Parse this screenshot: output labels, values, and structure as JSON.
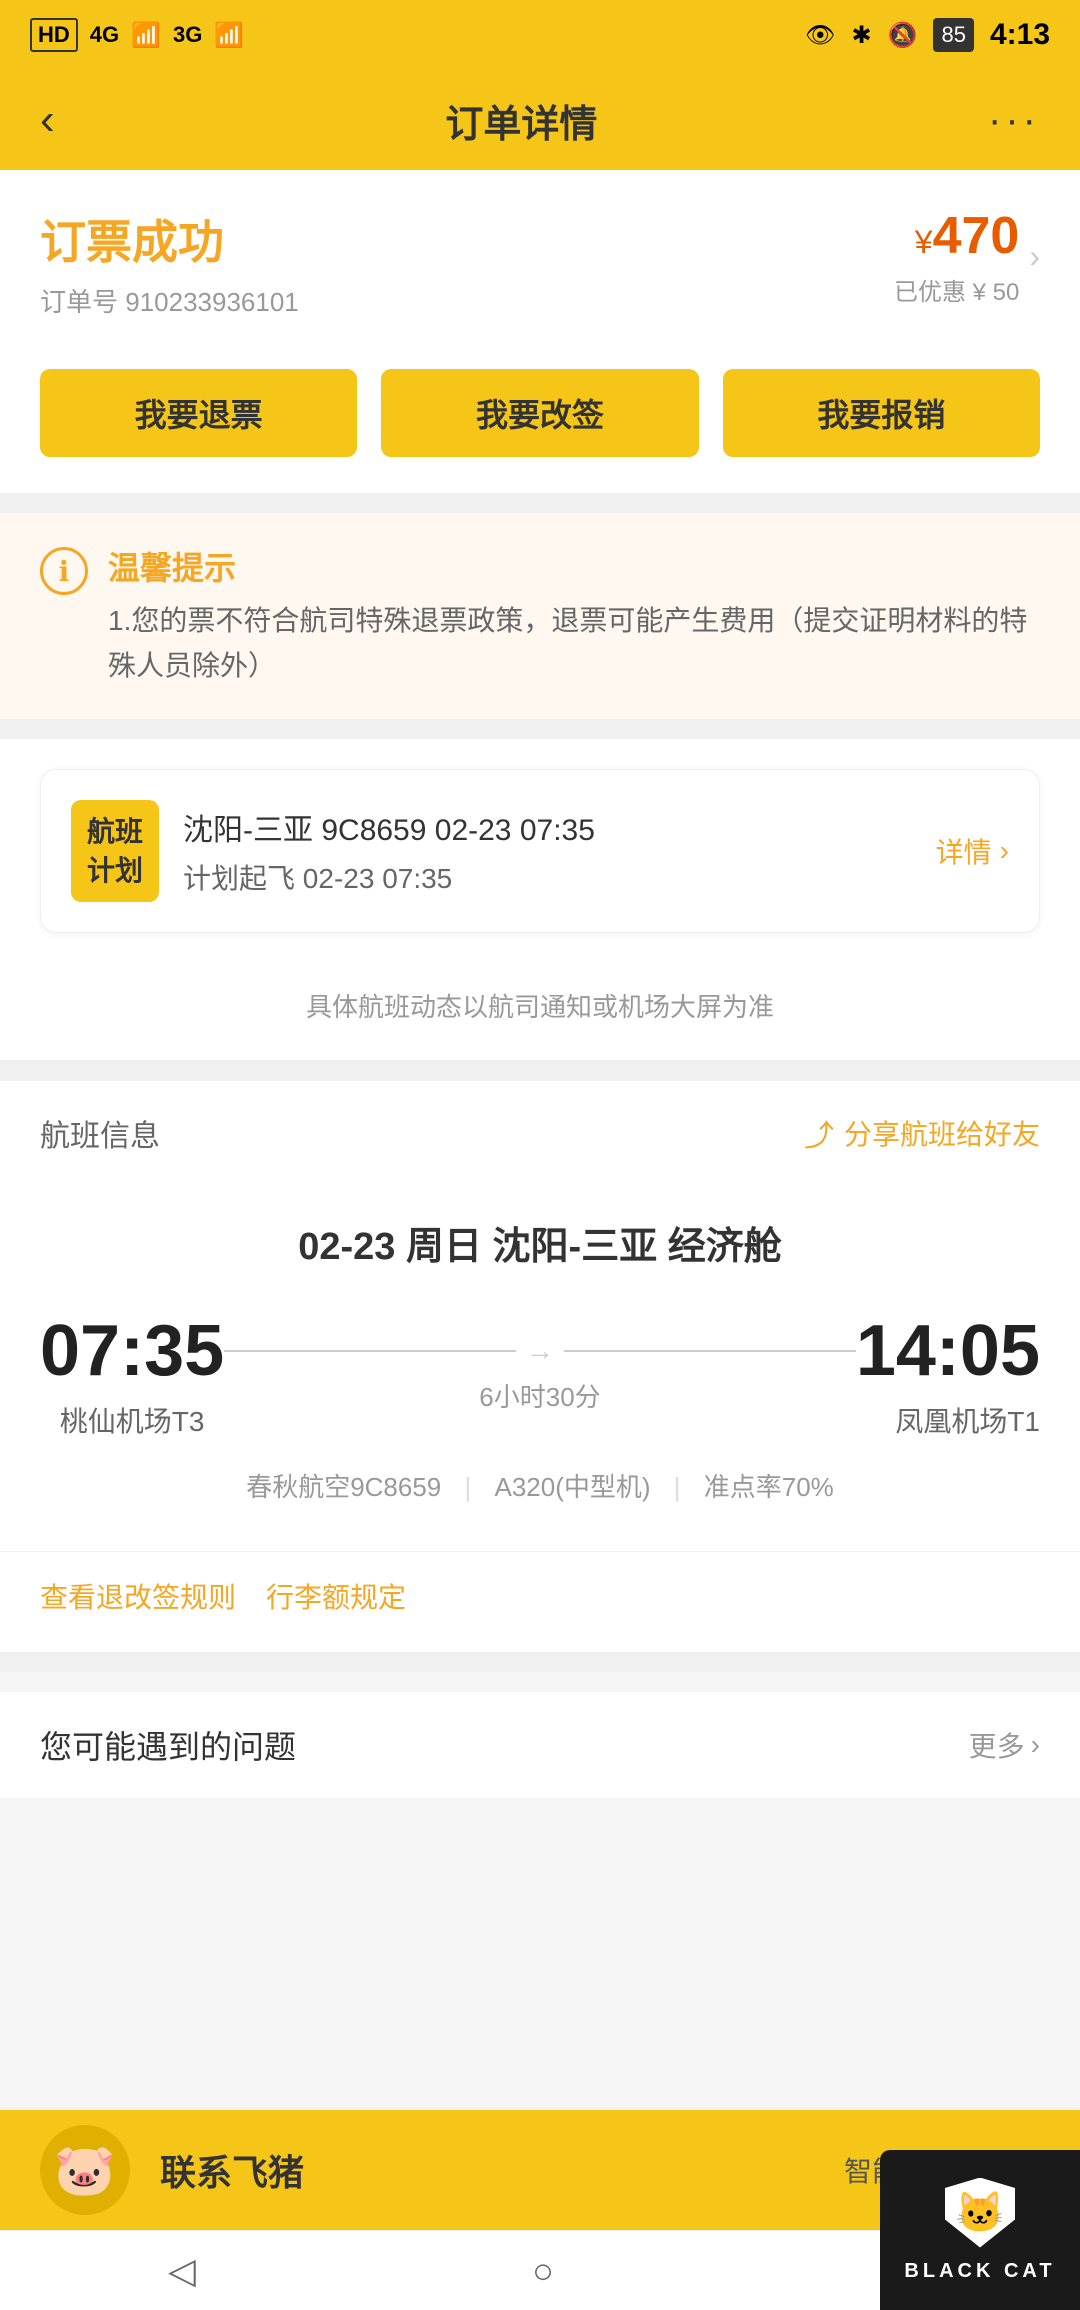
{
  "statusBar": {
    "left": "HD 4G 3G",
    "batteryLevel": "85",
    "time": "4:13"
  },
  "header": {
    "backLabel": "‹",
    "title": "订单详情",
    "moreLabel": "···"
  },
  "orderSuccess": {
    "successTitle": "订票成功",
    "orderNumberLabel": "订单号 910233936101",
    "priceCurrency": "¥",
    "price": "470",
    "discountLabel": "已优惠 ¥ 50"
  },
  "actionButtons": {
    "refund": "我要退票",
    "rebook": "我要改签",
    "invoice": "我要报销"
  },
  "warning": {
    "iconLabel": "ℹ",
    "title": "温馨提示",
    "text": "1.您的票不符合航司特殊退票政策，退票可能产生费用（提交证明材料的特殊人员除外）"
  },
  "flightPlan": {
    "badgeLine1": "航班",
    "badgeLine2": "计划",
    "route": "沈阳-三亚 9C8659 02-23 07:35",
    "planTime": "计划起飞 02-23 07:35",
    "detailLabel": "详情"
  },
  "flightNotice": "具体航班动态以航司通知或机场大屏为准",
  "flightInfoSection": {
    "title": "航班信息",
    "shareLabel": "分享航班给好友"
  },
  "flightDetails": {
    "dateRoute": "02-23  周日  沈阳-三亚  经济舱",
    "departTime": "07:35",
    "arriveTime": "14:05",
    "duration": "6小时30分",
    "departAirport": "桃仙机场T3",
    "arriveAirport": "凤凰机场T1",
    "airline": "春秋航空9C8659",
    "aircraft": "A320(中型机)",
    "onTimeRate": "准点率70%"
  },
  "rulesLinks": {
    "refundRule": "查看退改签规则",
    "baggageRule": "行李额规定"
  },
  "faq": {
    "title": "您可能遇到的问题",
    "moreLabel": "更多"
  },
  "bottomContact": {
    "name": "联系飞猪",
    "desc": "智能客服小助手",
    "avatarEmoji": "🐷"
  },
  "bottomNav": {
    "back": "◁",
    "home": "○",
    "recent": "□"
  },
  "blackCat": {
    "label": "BLACK CAT"
  }
}
